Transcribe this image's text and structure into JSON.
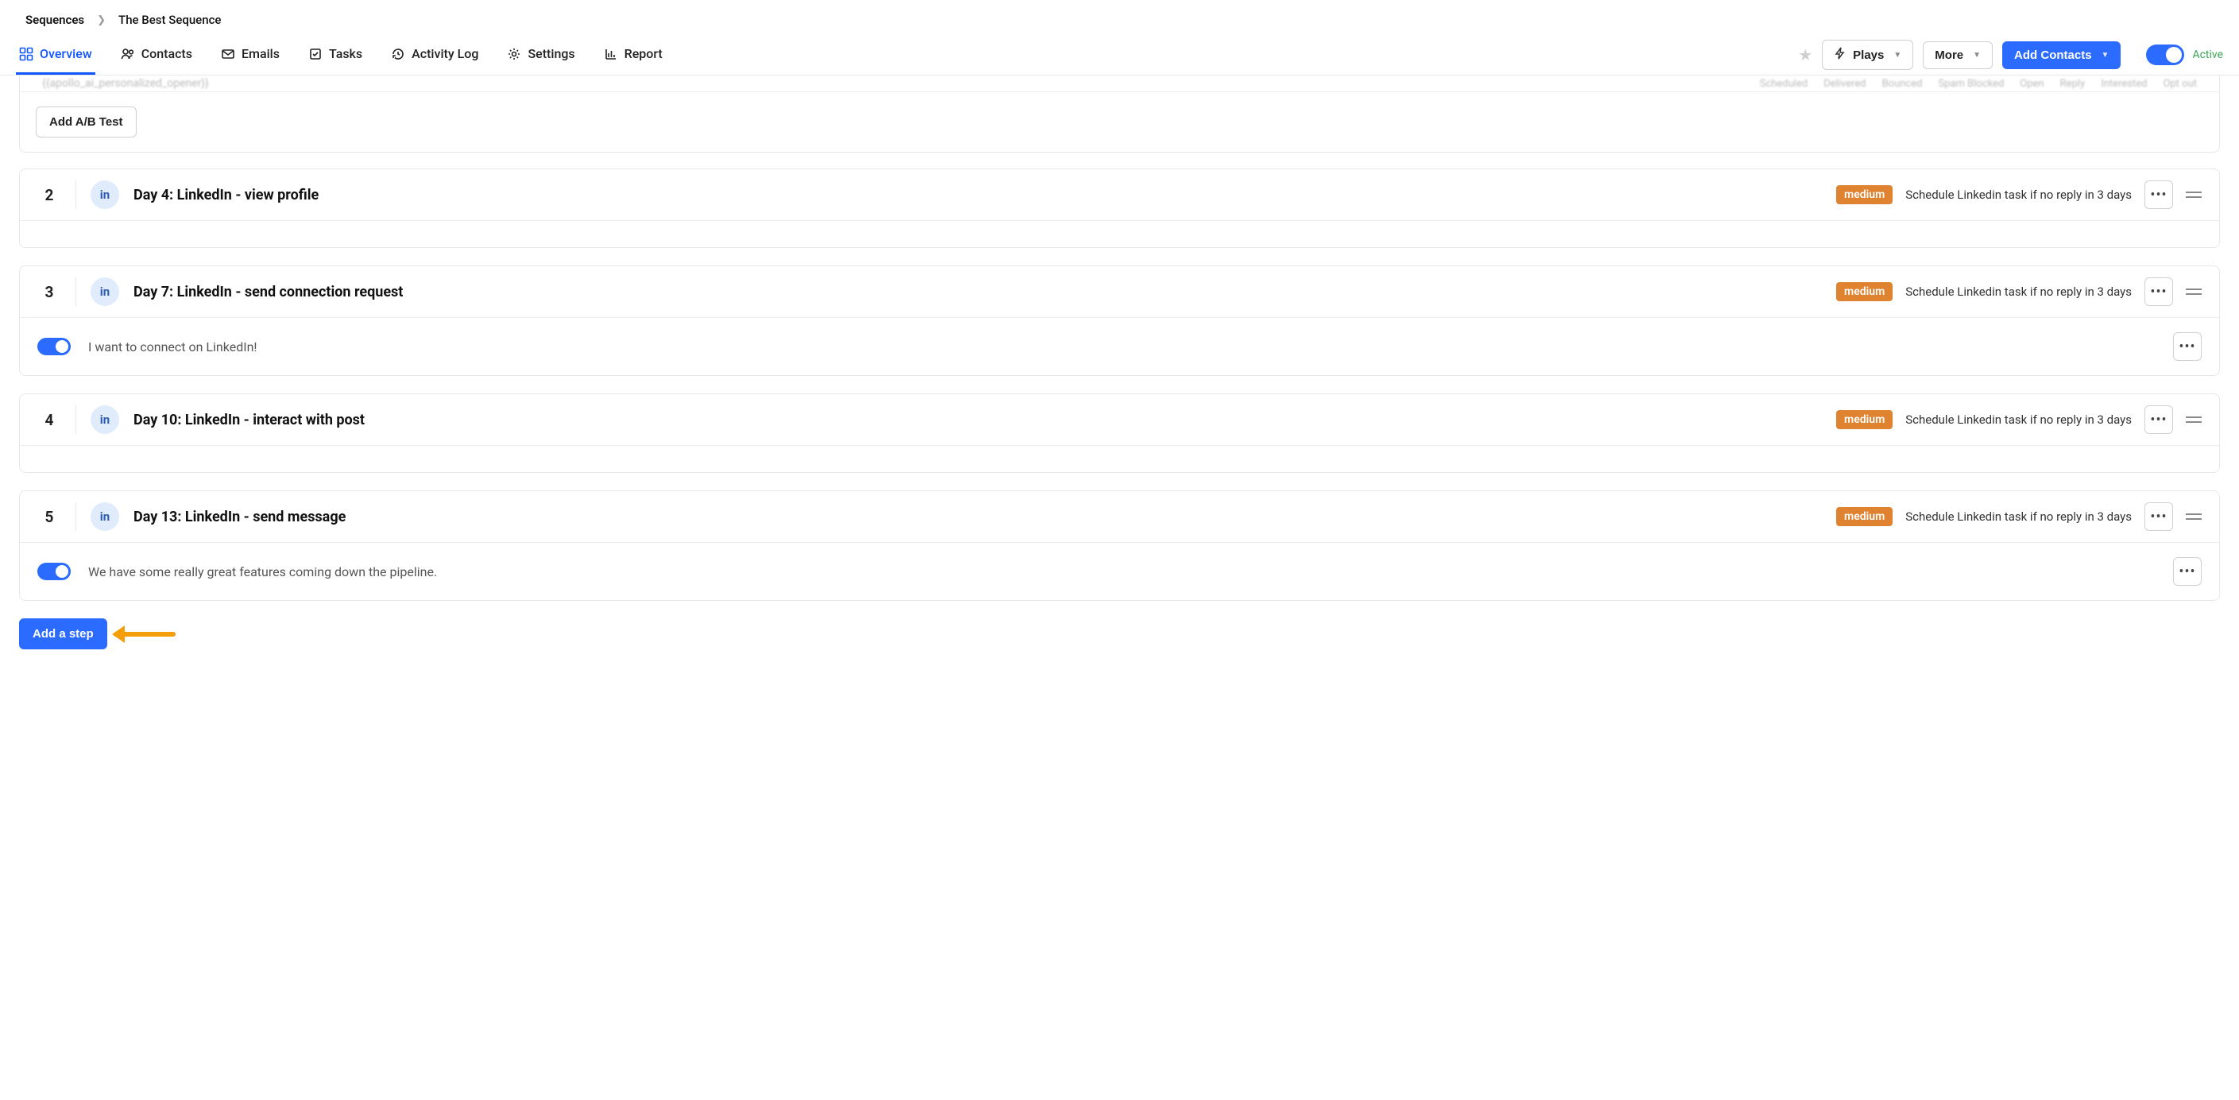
{
  "breadcrumb": {
    "root": "Sequences",
    "current": "The Best Sequence"
  },
  "tabs": {
    "overview": "Overview",
    "contacts": "Contacts",
    "emails": "Emails",
    "tasks": "Tasks",
    "activity": "Activity Log",
    "settings": "Settings",
    "report": "Report"
  },
  "toolbar": {
    "plays": "Plays",
    "more": "More",
    "add_contacts": "Add Contacts",
    "active_label": "Active"
  },
  "cutoff": {
    "left_text": "{{apollo_ai_personalized_opener}}",
    "stats": [
      "Scheduled",
      "Delivered",
      "Bounced",
      "Spam Blocked",
      "Open",
      "Reply",
      "Interested",
      "Opt out"
    ],
    "ab_label": "Add A/B Test"
  },
  "steps": [
    {
      "num": "2",
      "badge": "in",
      "title": "Day 4: LinkedIn - view profile",
      "pill": "medium",
      "sched": "Schedule Linkedin task if no reply in 3 days",
      "body": null
    },
    {
      "num": "3",
      "badge": "in",
      "title": "Day 7: LinkedIn - send connection request",
      "pill": "medium",
      "sched": "Schedule Linkedin task if no reply in 3 days",
      "body": {
        "toggle": true,
        "msg": "I want to connect on LinkedIn!"
      }
    },
    {
      "num": "4",
      "badge": "in",
      "title": "Day 10: LinkedIn - interact with post",
      "pill": "medium",
      "sched": "Schedule Linkedin task if no reply in 3 days",
      "body": null
    },
    {
      "num": "5",
      "badge": "in",
      "title": "Day 13: LinkedIn - send message",
      "pill": "medium",
      "sched": "Schedule Linkedin task if no reply in 3 days",
      "body": {
        "toggle": true,
        "msg": "We have some really great features coming down the pipeline."
      }
    }
  ],
  "add_step": "Add a step"
}
